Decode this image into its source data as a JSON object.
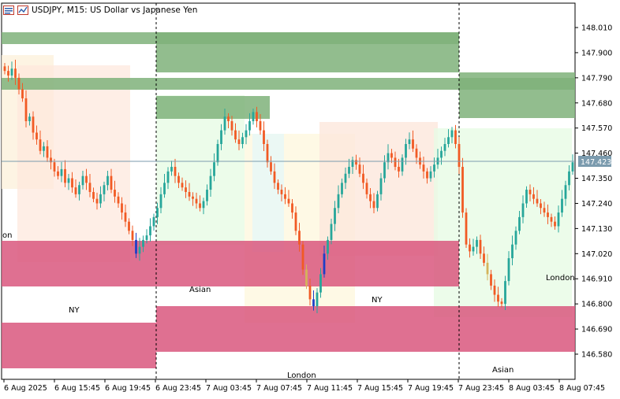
{
  "window": {
    "symbol": "USDJPY",
    "timeframe": "M15",
    "description": "US Dollar vs Japanese Yen",
    "title_sep": ", ",
    "title_sep2": ":  "
  },
  "icons": [
    "chart-window-icon",
    "indicators-icon"
  ],
  "colors": {
    "bull_candle": "#26a69a",
    "bear_candle": "#f15a24",
    "volume_up_candle": "#1f3ec7",
    "volume_down_candle": "#d4b35a",
    "supply_zone": "#7fb27a",
    "demand_zone": "#d9577e",
    "ny_session": "#fde7dc",
    "london_session": "#e7fbe5",
    "asian_session": "#fef7df",
    "price_line": "#7b9bae",
    "price_label_bg": "#7b9bae"
  },
  "price_axis": {
    "ticks": [
      "148.010",
      "147.900",
      "147.790",
      "147.680",
      "147.570",
      "147.460",
      "147.350",
      "147.240",
      "147.130",
      "147.020",
      "146.910",
      "146.800",
      "146.690",
      "146.580"
    ],
    "current_price": "147.423"
  },
  "time_axis": {
    "ticks": [
      "6 Aug 2025",
      "6 Aug 15:45",
      "6 Aug 19:45",
      "6 Aug 23:45",
      "7 Aug 03:45",
      "7 Aug 07:45",
      "7 Aug 11:45",
      "7 Aug 15:45",
      "7 Aug 19:45",
      "7 Aug 23:45",
      "8 Aug 03:45",
      "8 Aug 07:45"
    ]
  },
  "sessions": {
    "labels": [
      {
        "text": "on",
        "name": "session-label-london-partial"
      },
      {
        "text": "NY",
        "name": "session-label-ny-1"
      },
      {
        "text": "Asian",
        "name": "session-label-asian-1"
      },
      {
        "text": "London",
        "name": "session-label-london-1"
      },
      {
        "text": "NY",
        "name": "session-label-ny-2"
      },
      {
        "text": "Asian",
        "name": "session-label-asian-2"
      },
      {
        "text": "London",
        "name": "session-label-london-2"
      }
    ]
  },
  "chart_data": {
    "type": "candlestick",
    "symbol": "USDJPY",
    "timeframe": "M15",
    "current_price": 147.423,
    "ylim": [
      146.53,
      148.1
    ],
    "zones": {
      "supply": [
        {
          "from": "6 Aug 2025 11:00",
          "to": "7 Aug 23:45",
          "top": 147.98,
          "bottom": 147.95
        },
        {
          "from": "6 Aug 2025 11:00",
          "to": "8 Aug 09:15",
          "top": 147.82,
          "bottom": 147.72
        },
        {
          "from": "6 Aug 23:30",
          "to": "8 Aug 09:15",
          "top": 148.0,
          "bottom": 147.78
        },
        {
          "from": "6 Aug 23:30",
          "to": "7 Aug 06:00",
          "top": 147.7,
          "bottom": 147.62
        }
      ],
      "demand": [
        {
          "from": "6 Aug 2025 11:00",
          "to": "7 Aug 23:45",
          "top": 147.07,
          "bottom": 146.88
        },
        {
          "from": "6 Aug 2025 11:00",
          "to": "6 Aug 23:30",
          "top": 146.71,
          "bottom": 146.61
        },
        {
          "from": "6 Aug 23:30",
          "to": "8 Aug 09:15",
          "top": 146.79,
          "bottom": 146.61
        }
      ]
    },
    "closes": [
      147.82,
      147.8,
      147.83,
      147.79,
      147.74,
      147.7,
      147.6,
      147.62,
      147.55,
      147.52,
      147.47,
      147.49,
      147.44,
      147.42,
      147.38,
      147.36,
      147.39,
      147.33,
      147.35,
      147.31,
      147.28,
      147.32,
      147.36,
      147.33,
      147.29,
      147.26,
      147.24,
      147.28,
      147.32,
      147.36,
      147.3,
      147.27,
      147.24,
      147.2,
      147.16,
      147.12,
      147.08,
      147.02,
      147.05,
      147.08,
      147.1,
      147.14,
      147.18,
      147.22,
      147.28,
      147.33,
      147.38,
      147.4,
      147.36,
      147.33,
      147.31,
      147.29,
      147.27,
      147.26,
      147.24,
      147.22,
      147.25,
      147.3,
      147.36,
      147.42,
      147.5,
      147.56,
      147.62,
      147.6,
      147.56,
      147.52,
      147.5,
      147.53,
      147.56,
      147.6,
      147.64,
      147.6,
      147.56,
      147.5,
      147.42,
      147.38,
      147.33,
      147.3,
      147.28,
      147.26,
      147.24,
      147.2,
      147.12,
      147.06,
      146.95,
      146.88,
      146.82,
      146.79,
      146.85,
      146.93,
      147.02,
      147.08,
      147.15,
      147.22,
      147.28,
      147.33,
      147.37,
      147.4,
      147.43,
      147.41,
      147.37,
      147.33,
      147.28,
      147.25,
      147.22,
      147.28,
      147.35,
      147.42,
      147.46,
      147.44,
      147.4,
      147.38,
      147.44,
      147.5,
      147.52,
      147.48,
      147.44,
      147.41,
      147.38,
      147.35,
      147.38,
      147.41,
      147.44,
      147.47,
      147.5,
      147.53,
      147.56,
      147.5,
      147.4,
      147.2,
      147.06,
      147.03,
      147.05,
      147.08,
      147.02,
      146.98,
      146.93,
      146.88,
      146.84,
      146.81,
      146.8,
      146.9,
      147.0,
      147.06,
      147.12,
      147.18,
      147.24,
      147.3,
      147.28,
      147.26,
      147.24,
      147.22,
      147.2,
      147.18,
      147.16,
      147.14,
      147.2,
      147.26,
      147.32,
      147.38,
      147.42
    ]
  }
}
